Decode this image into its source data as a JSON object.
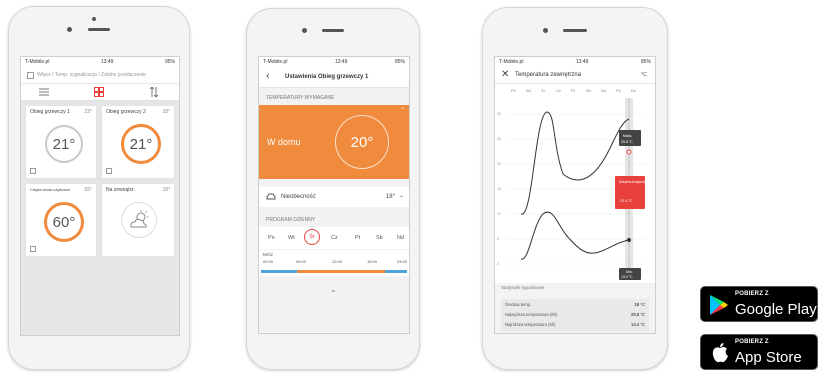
{
  "phone1": {
    "status_left": "T-Mobile.pl",
    "status_time": "13:49",
    "status_right": "95%",
    "notice": "Włącz / Temp. sygnalizacja / Zdalne przełączenie",
    "toolbar_icons": [
      "list-icon",
      "grid-icon",
      "sort-icon"
    ],
    "tiles": [
      {
        "title": "Obieg grzewczy 1",
        "setpoint": "22°",
        "value": "21°",
        "accent": "#b7b7b7"
      },
      {
        "title": "Obieg grzewczy 2",
        "setpoint": "18°",
        "value": "21°",
        "accent": "#f08a3c"
      },
      {
        "title": "Ciepła woda użytkowa",
        "setpoint": "55°",
        "value": "60°",
        "accent": "#f08a3c"
      },
      {
        "title": "Na zewnątrz",
        "setpoint": "18°",
        "value": "",
        "accent": "#b7b7b7"
      }
    ]
  },
  "phone2": {
    "status_left": "T-Mobile.pl",
    "status_time": "13:49",
    "status_right": "85%",
    "title": "Ustawienia Obieg grzewczy 1",
    "section_temp": "TEMPERATURY WYMAGANE",
    "mode_home": "W domu",
    "mode_home_value": "20°",
    "mode_away": "Nieobecność",
    "mode_away_value": "18°",
    "section_program": "PROGRAM DZIENNY",
    "days": [
      "Pn",
      "Wt",
      "Śr",
      "Cz",
      "Pt",
      "Sb",
      "Nd"
    ],
    "selected_day": "Śr",
    "timeline_label": "Mróz",
    "timeline_times": [
      "00:00",
      "06:00",
      "12:00",
      "18:00",
      "24:00"
    ],
    "accent": "#f08a3c"
  },
  "phone3": {
    "status_left": "T-Mobile.pl",
    "status_time": "13:49",
    "status_right": "85%",
    "title": "Temperatura zewnętrzna",
    "unit": "°C",
    "x_labels": [
      "Pn",
      "Wt",
      "Śr",
      "Cz",
      "Pt",
      "Sb",
      "Nd",
      "Pn",
      "Dz"
    ],
    "y_labels": [
      "30",
      "25",
      "20",
      "15",
      "10",
      "5",
      "0",
      "-5"
    ],
    "max_label": "Maks.",
    "max_value": "25.8 °C",
    "current_label": "Aktualna temperatura",
    "current_value": "23.4 °C",
    "min_label": "Min.",
    "min_value": "13.3 °C",
    "stats_title": "Statystyki tygodniowe",
    "stats": [
      {
        "label": "Średnia temp.",
        "value": "18 °C"
      },
      {
        "label": "Najwyższa temperatura (6h)",
        "value": "25.8 °C"
      },
      {
        "label": "Najniższa temperatura (6h)",
        "value": "13.4 °C"
      }
    ],
    "accent_red": "#e8413c"
  },
  "badges": {
    "google_small": "POBIERZ Z",
    "google_big": "Google Play",
    "apple_small": "POBIERZ Z",
    "apple_big": "App Store"
  }
}
